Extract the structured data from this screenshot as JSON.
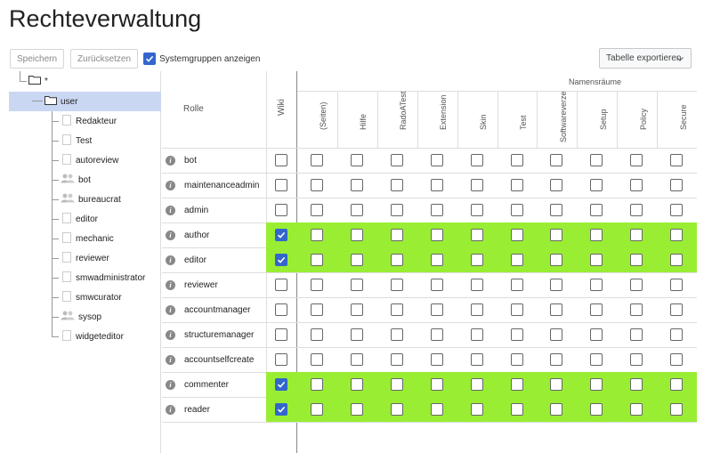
{
  "page_title": "Rechteverwaltung",
  "toolbar": {
    "save_label": "Speichern",
    "reset_label": "Zurücksetzen",
    "show_system_groups_label": "Systemgruppen anzeigen",
    "show_system_groups_checked": true,
    "export_label": "Tabelle exportieren"
  },
  "tree": {
    "root_label": "*",
    "user_label": "user",
    "children": [
      {
        "label": "Redakteur",
        "icon": "page-icon"
      },
      {
        "label": "Test",
        "icon": "page-icon"
      },
      {
        "label": "autoreview",
        "icon": "page-icon"
      },
      {
        "label": "bot",
        "icon": "group-icon"
      },
      {
        "label": "bureaucrat",
        "icon": "group-icon"
      },
      {
        "label": "editor",
        "icon": "page-icon"
      },
      {
        "label": "mechanic",
        "icon": "page-icon"
      },
      {
        "label": "reviewer",
        "icon": "page-icon"
      },
      {
        "label": "smwadministrator",
        "icon": "page-icon"
      },
      {
        "label": "smwcurator",
        "icon": "page-icon"
      },
      {
        "label": "sysop",
        "icon": "group-icon"
      },
      {
        "label": "widgeteditor",
        "icon": "page-icon"
      }
    ]
  },
  "grid": {
    "role_header": "Rolle",
    "wiki_header": "Wiki",
    "namespaces_header": "Namensräume",
    "namespaces": [
      "(Seiten)",
      "Hilfe",
      "RadoATest",
      "Extension",
      "Skin",
      "Test",
      "Softwareverzeichnis",
      "Setup",
      "Policy",
      "Secure"
    ],
    "roles": [
      {
        "name": "bot",
        "wiki": false
      },
      {
        "name": "maintenanceadmin",
        "wiki": false
      },
      {
        "name": "admin",
        "wiki": false
      },
      {
        "name": "author",
        "wiki": true
      },
      {
        "name": "editor",
        "wiki": true
      },
      {
        "name": "reviewer",
        "wiki": false
      },
      {
        "name": "accountmanager",
        "wiki": false
      },
      {
        "name": "structuremanager",
        "wiki": false
      },
      {
        "name": "accountselfcreate",
        "wiki": false
      },
      {
        "name": "commenter",
        "wiki": true
      },
      {
        "name": "reader",
        "wiki": true
      }
    ],
    "highlight_color": "#99ee33"
  }
}
